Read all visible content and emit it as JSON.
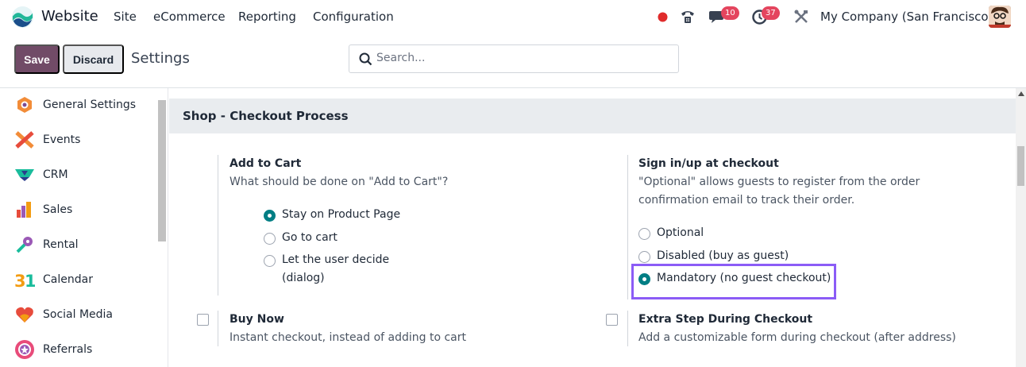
{
  "navbar": {
    "app_name": "Website",
    "menu": [
      "Site",
      "eCommerce",
      "Reporting",
      "Configuration"
    ],
    "messages_badge": "10",
    "activities_badge": "37",
    "company": "My Company (San Francisco)"
  },
  "control_panel": {
    "save_label": "Save",
    "discard_label": "Discard",
    "title": "Settings",
    "search_placeholder": "Search..."
  },
  "sidebar": {
    "items": [
      {
        "label": "General Settings",
        "icon": "general-settings-icon"
      },
      {
        "label": "Events",
        "icon": "events-icon"
      },
      {
        "label": "CRM",
        "icon": "crm-icon"
      },
      {
        "label": "Sales",
        "icon": "sales-icon"
      },
      {
        "label": "Rental",
        "icon": "rental-icon"
      },
      {
        "label": "Calendar",
        "icon": "calendar-icon"
      },
      {
        "label": "Social Media",
        "icon": "social-media-icon"
      },
      {
        "label": "Referrals",
        "icon": "referrals-icon"
      }
    ]
  },
  "section": {
    "title": "Shop - Checkout Process",
    "add_to_cart": {
      "title": "Add to Cart",
      "description": "What should be done on \"Add to Cart\"?",
      "options": [
        "Stay on Product Page",
        "Go to cart",
        "Let the user decide",
        "(dialog)"
      ],
      "selected": "Stay on Product Page"
    },
    "sign_in": {
      "title": "Sign in/up at checkout",
      "description_1": "\"Optional\" allows guests to register from the order",
      "description_2": "confirmation email to track their order.",
      "options": [
        "Optional",
        "Disabled (buy as guest)",
        "Mandatory (no guest checkout)"
      ],
      "selected": "Mandatory (no guest checkout)"
    },
    "buy_now": {
      "title": "Buy Now",
      "description": "Instant checkout, instead of adding to cart",
      "checked": false
    },
    "extra_step": {
      "title": "Extra Step During Checkout",
      "description": "Add a customizable form during checkout (after address)",
      "checked": false
    }
  },
  "colors": {
    "primary": "#714b67",
    "radio_checked": "#017e84",
    "highlight": "#8b5cf6",
    "badge": "#e4455e"
  }
}
